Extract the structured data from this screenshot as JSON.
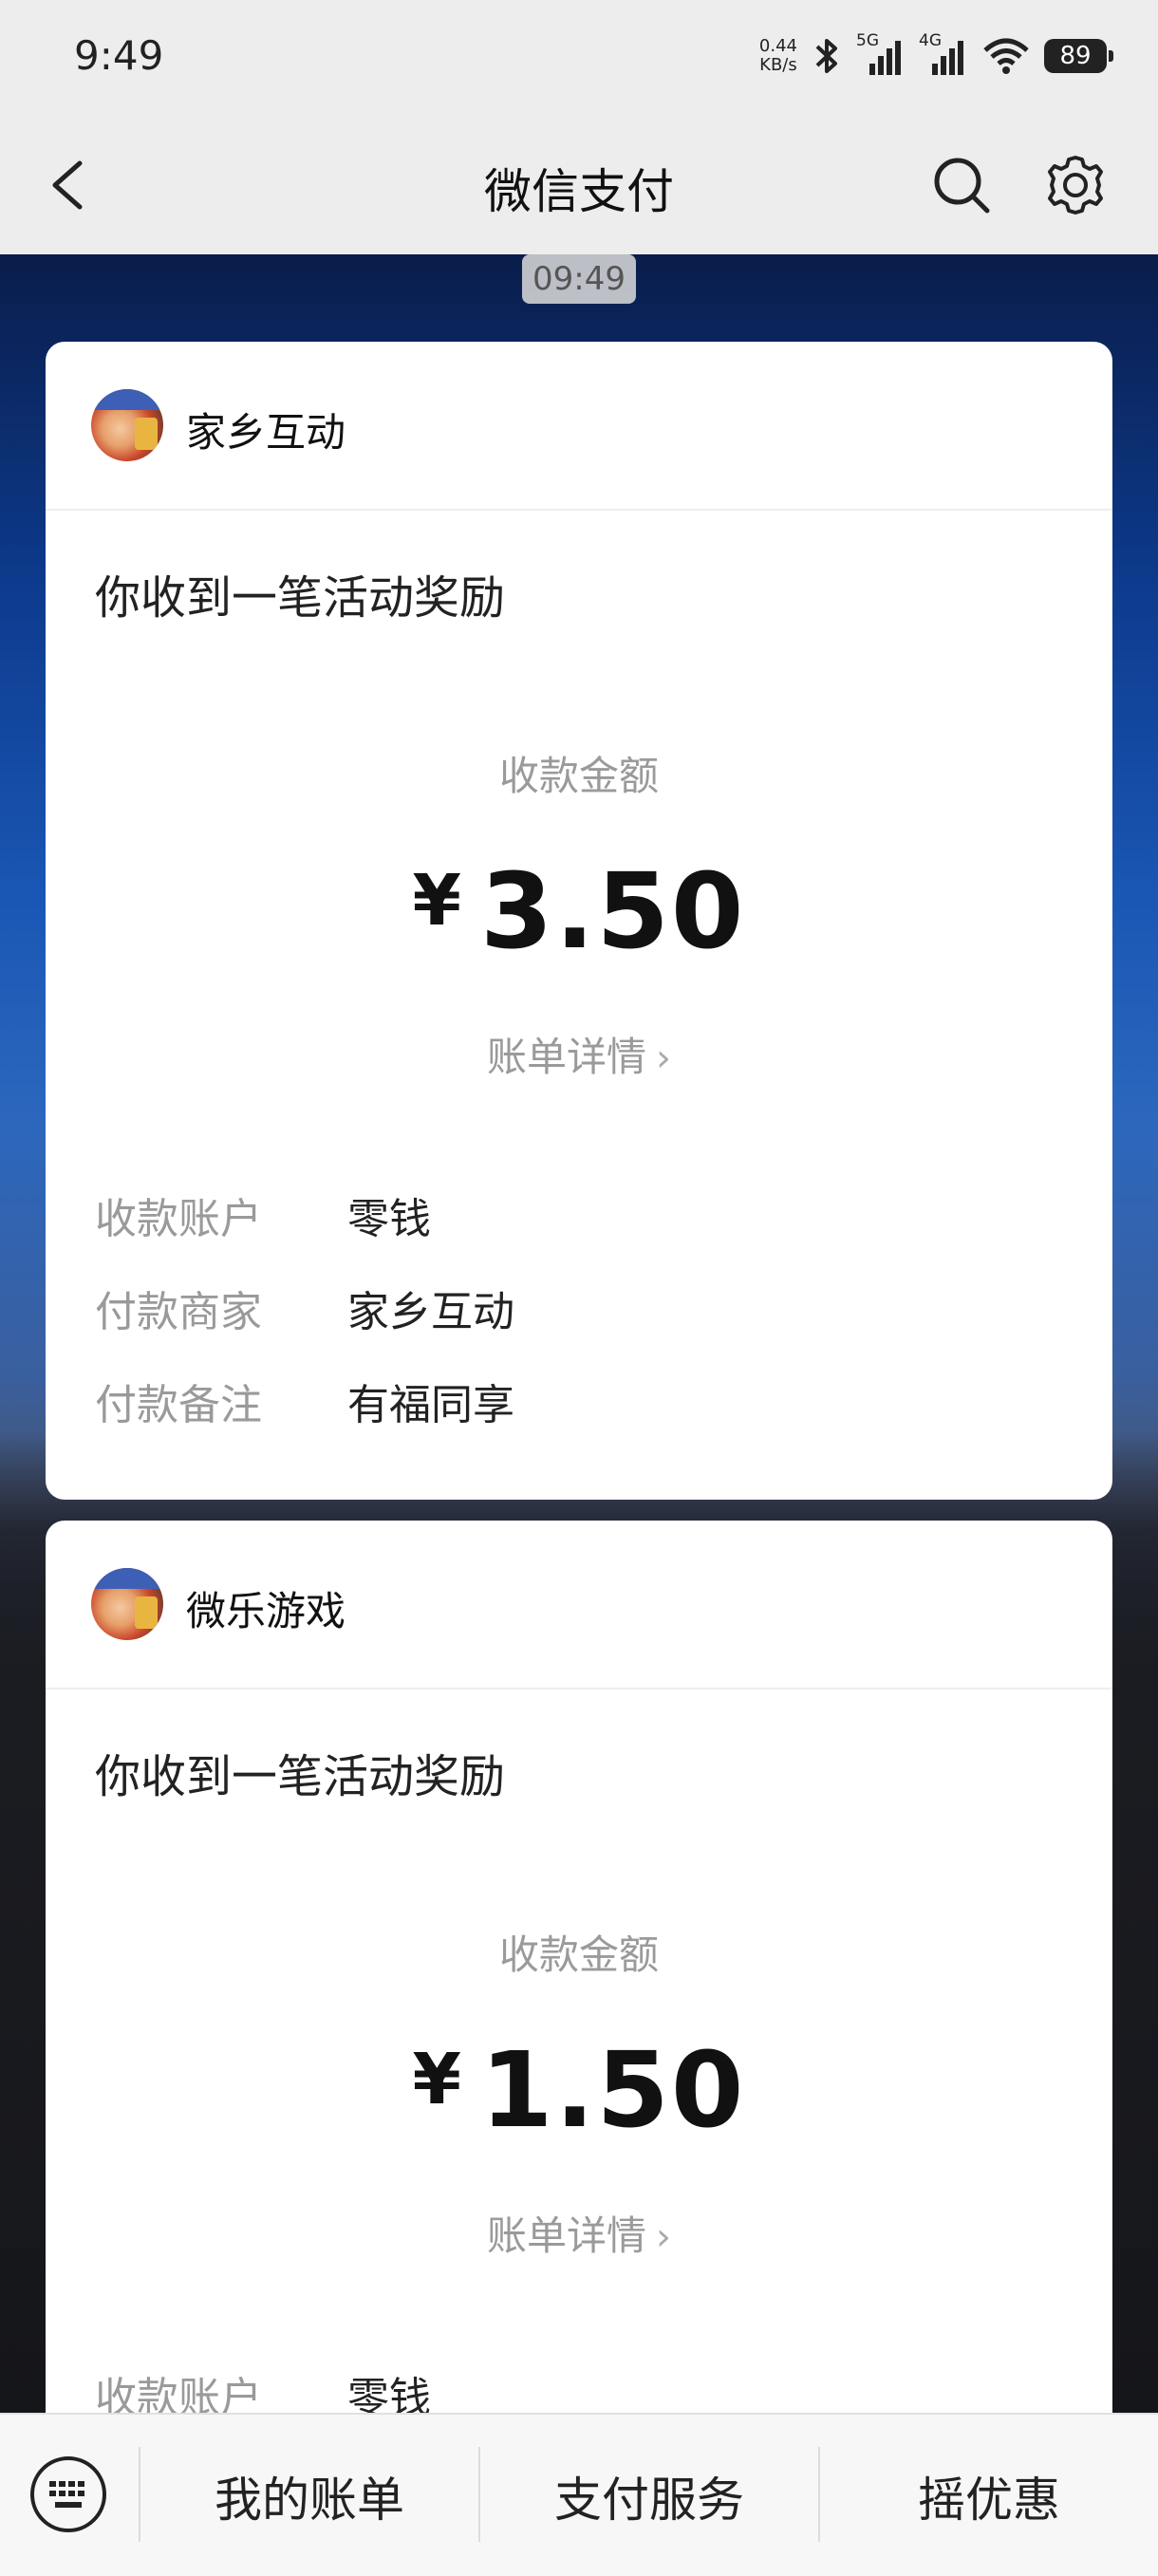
{
  "status_bar": {
    "time": "9:49",
    "net_speed_value": "0.44",
    "net_speed_unit": "KB/s",
    "sim1_label": "5G",
    "sim2_label": "4G",
    "battery": "89"
  },
  "header": {
    "title": "微信支付"
  },
  "chat": {
    "timestamp": "09:49"
  },
  "cards": [
    {
      "merchant": "家乡互动",
      "title": "你收到一笔活动奖励",
      "amount_label": "收款金额",
      "currency": "¥",
      "amount": "3.50",
      "detail_link": "账单详情",
      "rows": [
        {
          "key": "收款账户",
          "value": "零钱"
        },
        {
          "key": "付款商家",
          "value": "家乡互动"
        },
        {
          "key": "付款备注",
          "value": "有福同享"
        }
      ]
    },
    {
      "merchant": "微乐游戏",
      "title": "你收到一笔活动奖励",
      "amount_label": "收款金额",
      "currency": "¥",
      "amount": "1.50",
      "detail_link": "账单详情",
      "rows": [
        {
          "key": "收款账户",
          "value": "零钱"
        }
      ]
    }
  ],
  "bottom_menu": {
    "items": [
      "我的账单",
      "支付服务",
      "摇优惠"
    ]
  },
  "icons": {
    "back": "back-arrow-icon",
    "search": "search-icon",
    "settings": "gear-icon",
    "keyboard": "keyboard-icon",
    "bluetooth": "bluetooth-icon",
    "wifi": "wifi-icon"
  }
}
